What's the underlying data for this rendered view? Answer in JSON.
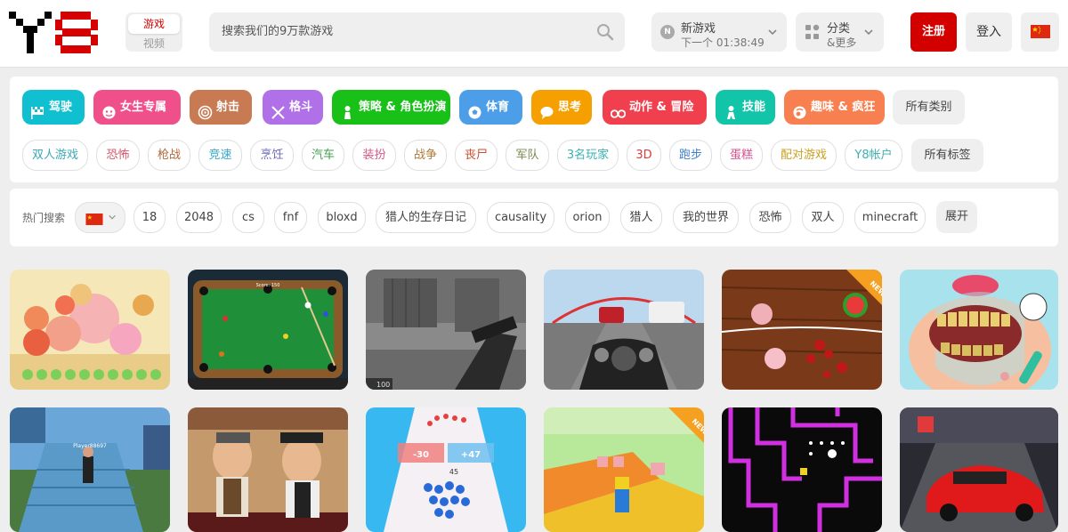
{
  "header": {
    "nav_game": "游戏",
    "nav_video": "视频",
    "search_placeholder": "搜索我们的9万款游戏",
    "new_games_title": "新游戏",
    "new_games_countdown": "下一个 01:38:49",
    "categories_title": "分类",
    "categories_sub": "&更多",
    "register": "注册",
    "login": "登入",
    "new_badge_letter": "N"
  },
  "categories": [
    {
      "label": "驾驶",
      "color": "#10c0d0",
      "icon": "flag-icon"
    },
    {
      "label": "女生专属",
      "color": "#f0508a",
      "icon": "face-icon"
    },
    {
      "label": "射击",
      "color": "#c87a52",
      "icon": "target-icon"
    },
    {
      "label": "格斗",
      "color": "#b070e8",
      "icon": "swords-icon"
    },
    {
      "label": "策略 & 角色扮演",
      "color": "#18c018",
      "icon": "chess-icon"
    },
    {
      "label": "体育",
      "color": "#4c9ee8",
      "icon": "ball-icon"
    },
    {
      "label": "思考",
      "color": "#f5a000",
      "icon": "speech-icon"
    },
    {
      "label": "动作 & 冒险",
      "color": "#f0404e",
      "icon": "binoculars-icon"
    },
    {
      "label": "技能",
      "color": "#12c4a8",
      "icon": "figure-icon"
    },
    {
      "label": "趣味 & 疯狂",
      "color": "#f77f50",
      "icon": "crazy-icon"
    }
  ],
  "all_categories": "所有类别",
  "tags": [
    {
      "label": "双人游戏",
      "color": "#3ba8b8"
    },
    {
      "label": "恐怖",
      "color": "#d4556a"
    },
    {
      "label": "枪战",
      "color": "#b06a3a"
    },
    {
      "label": "竞速",
      "color": "#3aa8c8"
    },
    {
      "label": "烹饪",
      "color": "#6a6ab8"
    },
    {
      "label": "汽车",
      "color": "#40a050"
    },
    {
      "label": "装扮",
      "color": "#d45a8a"
    },
    {
      "label": "战争",
      "color": "#b07a3a"
    },
    {
      "label": "丧尸",
      "color": "#c85030"
    },
    {
      "label": "军队",
      "color": "#7a8a50"
    },
    {
      "label": "3名玩家",
      "color": "#3ab0b0"
    },
    {
      "label": "3D",
      "color": "#d04040"
    },
    {
      "label": "跑步",
      "color": "#4080c8"
    },
    {
      "label": "蛋糕",
      "color": "#d45090"
    },
    {
      "label": "配对游戏",
      "color": "#c8a020"
    },
    {
      "label": "Y8帐户",
      "color": "#40b0b0"
    }
  ],
  "all_tags": "所有标签",
  "hot": {
    "label": "热门搜索",
    "items": [
      "18",
      "2048",
      "cs",
      "fnf",
      "bloxd",
      "猎人的生存日记",
      "causality",
      "orion",
      "猎人",
      "我的世界",
      "恐怖",
      "双人",
      "minecraft"
    ],
    "expand": "展开"
  },
  "games": [
    {
      "name": "fruit-merge-game",
      "badge": ""
    },
    {
      "name": "billiards-game",
      "badge": ""
    },
    {
      "name": "fps-shooter-game",
      "badge": ""
    },
    {
      "name": "moto-racer-game",
      "badge": ""
    },
    {
      "name": "fruit-slice-game",
      "badge": "NEW"
    },
    {
      "name": "dentist-game",
      "badge": ""
    },
    {
      "name": "parkour-game",
      "badge": ""
    },
    {
      "name": "cartoon-duel-game",
      "badge": ""
    },
    {
      "name": "crowd-runner-game",
      "badge": ""
    },
    {
      "name": "obby-3d-game",
      "badge": "NEW"
    },
    {
      "name": "neon-maze-game",
      "badge": ""
    },
    {
      "name": "car-racing-game",
      "badge": ""
    }
  ],
  "game_overlay_text": {
    "pool_score": "Score: 150",
    "shooter_ammo": "100",
    "runner_gate_minus": "-30",
    "runner_gate_plus": "+47",
    "runner_count": "45",
    "parkour_player": "Player88697"
  }
}
